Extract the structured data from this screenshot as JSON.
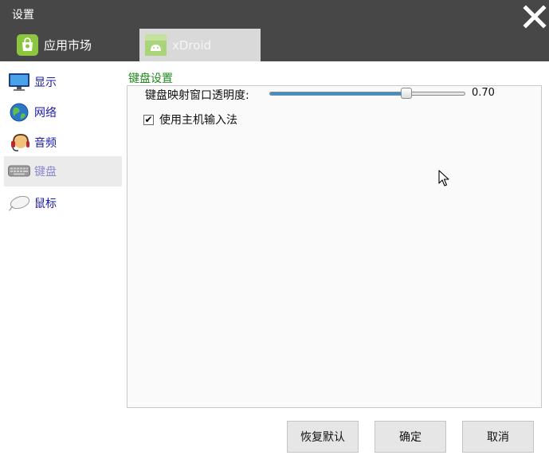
{
  "window": {
    "title": "设置"
  },
  "tabs": [
    {
      "label": "应用市场",
      "icon": "market-bag-icon"
    },
    {
      "label": "xDroid",
      "icon": "xdroid-android-icon",
      "active": true
    }
  ],
  "sidebar": {
    "items": [
      {
        "label": "显示",
        "icon": "monitor-icon"
      },
      {
        "label": "网络",
        "icon": "globe-network-icon"
      },
      {
        "label": "音频",
        "icon": "audio-headset-icon"
      },
      {
        "label": "键盘",
        "icon": "keyboard-icon",
        "active": true
      },
      {
        "label": "鼠标",
        "icon": "mouse-icon"
      }
    ]
  },
  "keyboard_settings": {
    "section_title": "键盘设置",
    "opacity_label": "键盘映射窗口透明度:",
    "opacity_value": "0.70",
    "opacity_fraction": 0.7,
    "use_host_ime_label": "使用主机输入法",
    "use_host_ime_checked": true
  },
  "buttons": {
    "reset": "恢复默认",
    "ok": "确定",
    "cancel": "取消"
  },
  "colors": {
    "header_bg": "#474747",
    "section_title": "#1f8a1f",
    "sidebar_text": "#1a1aa6",
    "slider_fill": "#3a8fd0"
  }
}
